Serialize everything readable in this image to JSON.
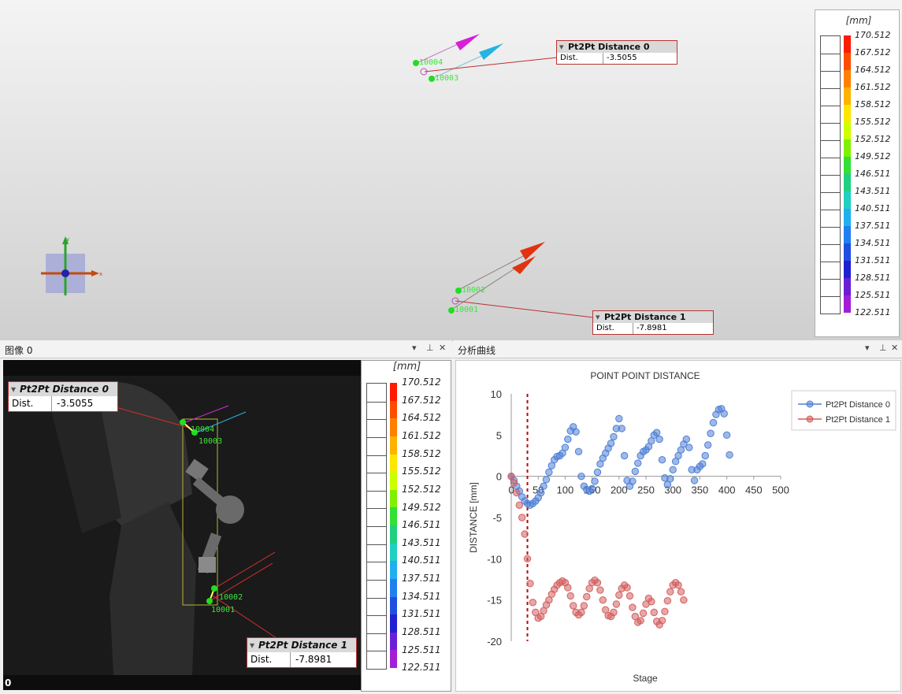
{
  "viewport3d": {
    "points": [
      "10004",
      "10003",
      "10002",
      "10001"
    ],
    "axis_x": "x",
    "axis_y": "y",
    "distance0": {
      "title": "Pt2Pt Distance 0",
      "key": "Dist.",
      "value": "-3.5055"
    },
    "distance1": {
      "title": "Pt2Pt Distance 1",
      "key": "Dist.",
      "value": "-7.8981"
    },
    "colorbar": {
      "unit": "[mm]",
      "values": [
        "170.512",
        "167.512",
        "164.512",
        "161.512",
        "158.512",
        "155.512",
        "152.512",
        "149.512",
        "146.511",
        "143.511",
        "140.511",
        "137.511",
        "134.511",
        "131.511",
        "128.511",
        "125.511",
        "122.511"
      ]
    }
  },
  "image_panel": {
    "title": "图像 0",
    "pin_icon": "pin-icon",
    "close_icon": "close-icon",
    "frame": "0",
    "points": [
      "10004",
      "10003",
      "10002",
      "10001"
    ],
    "distance0": {
      "title": "Pt2Pt Distance 0",
      "key": "Dist.",
      "value": "-3.5055"
    },
    "distance1": {
      "title": "Pt2Pt Distance 1",
      "key": "Dist.",
      "value": "-7.8981"
    },
    "colorbar": {
      "unit": "[mm]",
      "values": [
        "170.512",
        "167.512",
        "164.512",
        "161.512",
        "158.512",
        "155.512",
        "152.512",
        "149.512",
        "146.511",
        "143.511",
        "140.511",
        "137.511",
        "134.511",
        "131.511",
        "128.511",
        "125.511",
        "122.511"
      ]
    }
  },
  "chart_panel": {
    "title": "分析曲线",
    "pin_icon": "pin-icon",
    "close_icon": "close-icon"
  },
  "colors": {
    "series0": "#4f7fd6",
    "series1": "#d45f5f",
    "marker_line": "#c00000",
    "point_green": "#22dd22"
  },
  "chart_data": {
    "type": "scatter",
    "title": "POINT POINT DISTANCE",
    "xlabel": "Stage",
    "ylabel": "DISTANCE [mm]",
    "xlim": [
      0,
      500
    ],
    "ylim": [
      -20,
      10
    ],
    "xticks": [
      0,
      50,
      100,
      150,
      200,
      250,
      300,
      350,
      400,
      450,
      500
    ],
    "yticks": [
      10,
      5,
      0,
      -5,
      -10,
      -15,
      -20
    ],
    "grid": false,
    "legend": "top-right",
    "vertical_marker_x": 30,
    "series": [
      {
        "name": "Pt2Pt Distance 0",
        "points": [
          [
            0,
            0
          ],
          [
            5,
            -0.5
          ],
          [
            10,
            -1.2
          ],
          [
            15,
            -1.8
          ],
          [
            20,
            -2.5
          ],
          [
            25,
            -3
          ],
          [
            30,
            -3.3
          ],
          [
            35,
            -3.5
          ],
          [
            40,
            -3.3
          ],
          [
            45,
            -3
          ],
          [
            50,
            -2.6
          ],
          [
            55,
            -2
          ],
          [
            60,
            -1.2
          ],
          [
            65,
            -0.4
          ],
          [
            70,
            0.5
          ],
          [
            75,
            1.3
          ],
          [
            80,
            2
          ],
          [
            85,
            2.4
          ],
          [
            90,
            2.5
          ],
          [
            95,
            2.8
          ],
          [
            100,
            3.5
          ],
          [
            105,
            4.5
          ],
          [
            110,
            5.5
          ],
          [
            115,
            6
          ],
          [
            120,
            5.4
          ],
          [
            125,
            3
          ],
          [
            130,
            0
          ],
          [
            135,
            -1.2
          ],
          [
            140,
            -1.6
          ],
          [
            145,
            -1.8
          ],
          [
            150,
            -1.5
          ],
          [
            155,
            -0.6
          ],
          [
            160,
            0.5
          ],
          [
            165,
            1.5
          ],
          [
            170,
            2.2
          ],
          [
            175,
            2.8
          ],
          [
            180,
            3.4
          ],
          [
            185,
            4
          ],
          [
            190,
            4.8
          ],
          [
            195,
            5.8
          ],
          [
            200,
            7
          ],
          [
            205,
            5.8
          ],
          [
            210,
            2.5
          ],
          [
            215,
            -0.5
          ],
          [
            220,
            -1.2
          ],
          [
            225,
            -0.6
          ],
          [
            230,
            0.6
          ],
          [
            235,
            1.6
          ],
          [
            240,
            2.5
          ],
          [
            245,
            3
          ],
          [
            250,
            3.2
          ],
          [
            255,
            3.6
          ],
          [
            260,
            4.3
          ],
          [
            265,
            5
          ],
          [
            270,
            5.3
          ],
          [
            275,
            4.5
          ],
          [
            280,
            2
          ],
          [
            285,
            -0.2
          ],
          [
            290,
            -1
          ],
          [
            295,
            -0.3
          ],
          [
            300,
            0.8
          ],
          [
            305,
            1.8
          ],
          [
            310,
            2.5
          ],
          [
            315,
            3.2
          ],
          [
            320,
            3.9
          ],
          [
            325,
            4.5
          ],
          [
            330,
            3.5
          ],
          [
            335,
            0.8
          ],
          [
            340,
            -0.5
          ],
          [
            345,
            0.8
          ],
          [
            350,
            1.2
          ],
          [
            355,
            1.5
          ],
          [
            360,
            2.5
          ],
          [
            365,
            3.8
          ],
          [
            370,
            5.2
          ],
          [
            375,
            6.5
          ],
          [
            380,
            7.5
          ],
          [
            385,
            8.1
          ],
          [
            390,
            8.2
          ],
          [
            395,
            7.6
          ],
          [
            400,
            5
          ],
          [
            405,
            2.6
          ]
        ]
      },
      {
        "name": "Pt2Pt Distance 1",
        "points": [
          [
            0,
            0
          ],
          [
            5,
            -0.8
          ],
          [
            10,
            -2
          ],
          [
            15,
            -3.5
          ],
          [
            20,
            -5
          ],
          [
            25,
            -7
          ],
          [
            30,
            -10
          ],
          [
            35,
            -13
          ],
          [
            40,
            -15.3
          ],
          [
            45,
            -16.5
          ],
          [
            50,
            -17.2
          ],
          [
            55,
            -17
          ],
          [
            60,
            -16.3
          ],
          [
            65,
            -15.6
          ],
          [
            70,
            -15
          ],
          [
            75,
            -14.3
          ],
          [
            80,
            -13.7
          ],
          [
            85,
            -13.2
          ],
          [
            90,
            -12.9
          ],
          [
            95,
            -12.7
          ],
          [
            100,
            -12.9
          ],
          [
            105,
            -13.5
          ],
          [
            110,
            -14.5
          ],
          [
            115,
            -15.7
          ],
          [
            120,
            -16.5
          ],
          [
            125,
            -16.8
          ],
          [
            130,
            -16.5
          ],
          [
            135,
            -15.7
          ],
          [
            140,
            -14.6
          ],
          [
            145,
            -13.6
          ],
          [
            150,
            -12.9
          ],
          [
            155,
            -12.6
          ],
          [
            160,
            -12.9
          ],
          [
            165,
            -13.8
          ],
          [
            170,
            -15
          ],
          [
            175,
            -16.2
          ],
          [
            180,
            -16.9
          ],
          [
            185,
            -17
          ],
          [
            190,
            -16.5
          ],
          [
            195,
            -15.5
          ],
          [
            200,
            -14.4
          ],
          [
            205,
            -13.6
          ],
          [
            210,
            -13.2
          ],
          [
            215,
            -13.5
          ],
          [
            220,
            -14.5
          ],
          [
            225,
            -15.9
          ],
          [
            230,
            -17
          ],
          [
            235,
            -17.7
          ],
          [
            240,
            -17.5
          ],
          [
            245,
            -16.6
          ],
          [
            250,
            -15.5
          ],
          [
            255,
            -14.8
          ],
          [
            260,
            -15.2
          ],
          [
            265,
            -16.5
          ],
          [
            270,
            -17.6
          ],
          [
            275,
            -18
          ],
          [
            280,
            -17.5
          ],
          [
            285,
            -16.4
          ],
          [
            290,
            -15.1
          ],
          [
            295,
            -14
          ],
          [
            300,
            -13.2
          ],
          [
            305,
            -12.9
          ],
          [
            310,
            -13.2
          ],
          [
            315,
            -14
          ],
          [
            320,
            -15
          ]
        ]
      }
    ]
  }
}
